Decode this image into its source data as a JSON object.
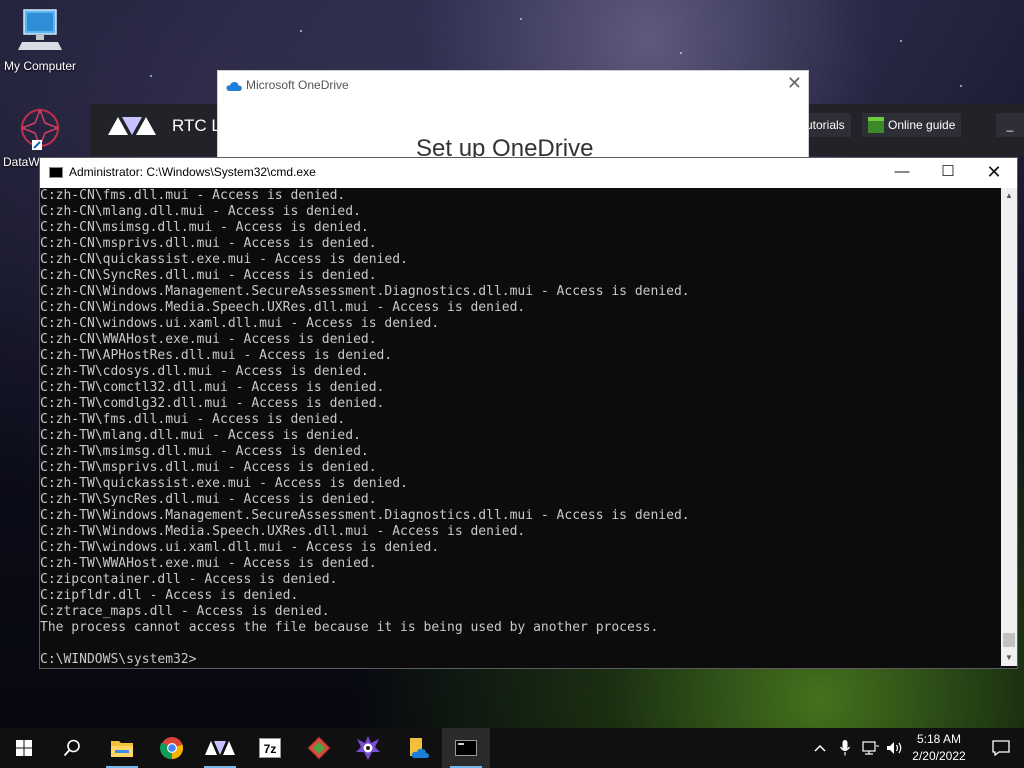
{
  "desktop": {
    "icons": [
      {
        "label": "My Computer"
      },
      {
        "label": "DataW"
      }
    ]
  },
  "rtc_app": {
    "title": "RTC La",
    "tutorials_label": "utorials",
    "online_guide_label": "Online guide",
    "minimize_label": "_"
  },
  "onedrive": {
    "title": "Microsoft OneDrive",
    "heading": "Set up OneDrive",
    "close_label": "✕"
  },
  "cmd": {
    "title": "Administrator: C:\\Windows\\System32\\cmd.exe",
    "minimize_label": "—",
    "maximize_label": "☐",
    "close_label": "✕",
    "lines": [
      "C:zh-CN\\fms.dll.mui - Access is denied.",
      "C:zh-CN\\mlang.dll.mui - Access is denied.",
      "C:zh-CN\\msimsg.dll.mui - Access is denied.",
      "C:zh-CN\\msprivs.dll.mui - Access is denied.",
      "C:zh-CN\\quickassist.exe.mui - Access is denied.",
      "C:zh-CN\\SyncRes.dll.mui - Access is denied.",
      "C:zh-CN\\Windows.Management.SecureAssessment.Diagnostics.dll.mui - Access is denied.",
      "C:zh-CN\\Windows.Media.Speech.UXRes.dll.mui - Access is denied.",
      "C:zh-CN\\windows.ui.xaml.dll.mui - Access is denied.",
      "C:zh-CN\\WWAHost.exe.mui - Access is denied.",
      "C:zh-TW\\APHostRes.dll.mui - Access is denied.",
      "C:zh-TW\\cdosys.dll.mui - Access is denied.",
      "C:zh-TW\\comctl32.dll.mui - Access is denied.",
      "C:zh-TW\\comdlg32.dll.mui - Access is denied.",
      "C:zh-TW\\fms.dll.mui - Access is denied.",
      "C:zh-TW\\mlang.dll.mui - Access is denied.",
      "C:zh-TW\\msimsg.dll.mui - Access is denied.",
      "C:zh-TW\\msprivs.dll.mui - Access is denied.",
      "C:zh-TW\\quickassist.exe.mui - Access is denied.",
      "C:zh-TW\\SyncRes.dll.mui - Access is denied.",
      "C:zh-TW\\Windows.Management.SecureAssessment.Diagnostics.dll.mui - Access is denied.",
      "C:zh-TW\\Windows.Media.Speech.UXRes.dll.mui - Access is denied.",
      "C:zh-TW\\windows.ui.xaml.dll.mui - Access is denied.",
      "C:zh-TW\\WWAHost.exe.mui - Access is denied.",
      "C:zipcontainer.dll - Access is denied.",
      "C:zipfldr.dll - Access is denied.",
      "C:ztrace_maps.dll - Access is denied.",
      "The process cannot access the file because it is being used by another process.",
      "",
      "C:\\WINDOWS\\system32>"
    ]
  },
  "taskbar": {
    "apps": [
      "start-icon",
      "search-icon",
      "file-explorer-icon",
      "chrome-icon",
      "avid-icon",
      "7zip-icon",
      "app-red-icon",
      "game-icon",
      "files-onedrive-icon",
      "cmd-icon"
    ],
    "clock_time": "5:18 AM",
    "clock_date": "2/20/2022"
  },
  "colors": {
    "cmd_bg": "#0c0c0c",
    "cmd_text": "#c8c8c8",
    "taskbar_bg": "#101010",
    "accent": "#76b9ed"
  }
}
